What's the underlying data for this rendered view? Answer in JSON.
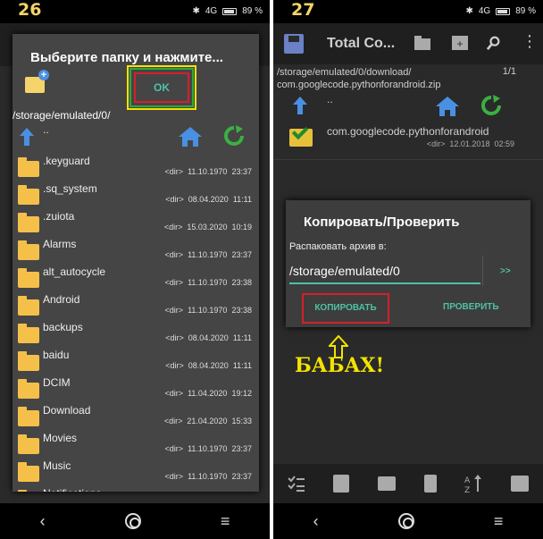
{
  "left": {
    "step": "26",
    "status": {
      "network": "4G",
      "battery": "89 %"
    },
    "dialog": {
      "title": "Выберите папку и нажмите...",
      "ok_label": "OK",
      "path": "/storage/emulated/0/",
      "parent": ".."
    },
    "items": [
      {
        "name": ".keyguard",
        "type": "<dir>",
        "date": "11.10.1970",
        "time": "23:37"
      },
      {
        "name": ".sq_system",
        "type": "<dir>",
        "date": "08.04.2020",
        "time": "11:11"
      },
      {
        "name": ".zuiota",
        "type": "<dir>",
        "date": "15.03.2020",
        "time": "10:19"
      },
      {
        "name": "Alarms",
        "type": "<dir>",
        "date": "11.10.1970",
        "time": "23:37"
      },
      {
        "name": "alt_autocycle",
        "type": "<dir>",
        "date": "11.10.1970",
        "time": "23:38"
      },
      {
        "name": "Android",
        "type": "<dir>",
        "date": "11.10.1970",
        "time": "23:38"
      },
      {
        "name": "backups",
        "type": "<dir>",
        "date": "08.04.2020",
        "time": "11:11"
      },
      {
        "name": "baidu",
        "type": "<dir>",
        "date": "08.04.2020",
        "time": "11:11"
      },
      {
        "name": "DCIM",
        "type": "<dir>",
        "date": "11.04.2020",
        "time": "19:12"
      },
      {
        "name": "Download",
        "type": "<dir>",
        "date": "21.04.2020",
        "time": "15:33"
      },
      {
        "name": "Movies",
        "type": "<dir>",
        "date": "11.10.1970",
        "time": "23:37"
      },
      {
        "name": "Music",
        "type": "<dir>",
        "date": "11.10.1970",
        "time": "23:37"
      },
      {
        "name": "Notifications",
        "type": "",
        "date": "",
        "time": ""
      }
    ],
    "nav": {
      "back": "‹",
      "menu": "≡"
    }
  },
  "right": {
    "step": "27",
    "status": {
      "network": "4G",
      "battery": "89 %"
    },
    "toolbar_title": "Total Co...",
    "path_line1": "/storage/emulated/0/download/",
    "path_line2": "com.googlecode.pythonforandroid.zip",
    "count": "1/1",
    "parent": "..",
    "zip": {
      "name": "com.googlecode.pythonforandroid",
      "type": "<dir>",
      "date": "12.01.2018",
      "time": "02:59"
    },
    "dialog": {
      "title": "Копировать/Проверить",
      "label": "Распаковать архив в:",
      "input_value": "/storage/emulated/0",
      "more": ">>",
      "copy_label": "КОПИРОВАТЬ",
      "check_label": "ПРОВЕРИТЬ"
    },
    "annotation": "БАБАХ!",
    "nav": {
      "back": "‹",
      "menu": "≡"
    }
  },
  "colors": {
    "accent": "#4ec1a6",
    "highlight_red": "#d81e2a",
    "highlight_yellow": "#f4e300",
    "highlight_green": "#2fa83a",
    "folder": "#f5c04a"
  }
}
